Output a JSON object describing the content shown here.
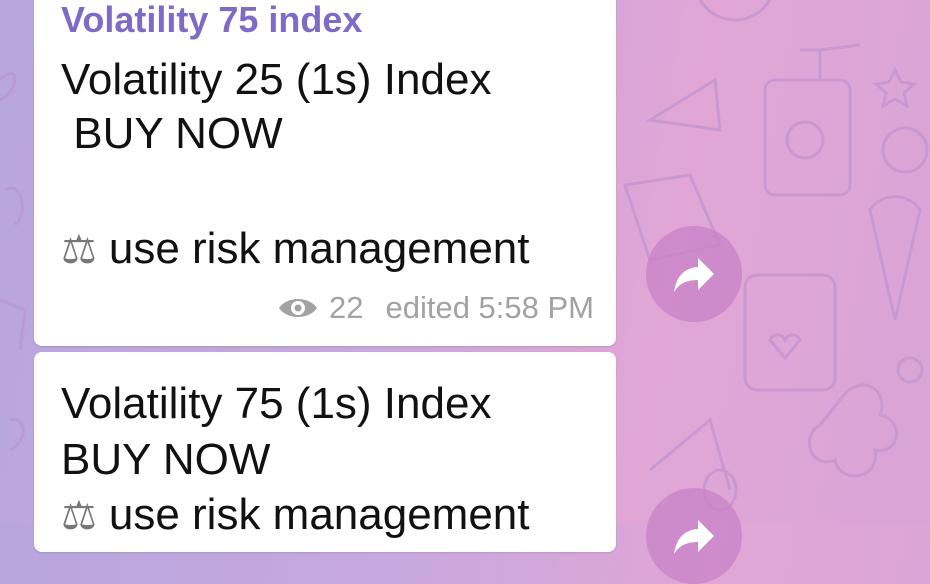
{
  "messages": [
    {
      "sender": "Volatility 75 index",
      "line1": "Volatility 25 (1s) Index",
      "line2": " BUY NOW",
      "risk": "use risk management",
      "views": "22",
      "edited_time": "edited 5:58 PM"
    },
    {
      "line1": "Volatility 75 (1s) Index",
      "line2": "BUY NOW",
      "risk": "use risk management"
    }
  ],
  "icons": {
    "risk_emoji": "⚖",
    "views_icon": "eye-icon",
    "share_icon": "share-arrow-icon"
  },
  "colors": {
    "sender_name": "#7e6bc7",
    "share_button": "#c882c8",
    "meta_text": "#a2a2a2"
  }
}
